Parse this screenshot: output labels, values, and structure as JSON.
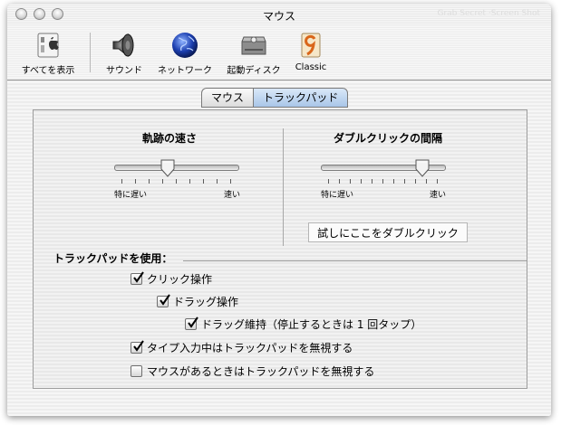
{
  "window": {
    "title": "マウス",
    "ghost_text": "Grab Secret ·Screen Shot"
  },
  "toolbar": {
    "items": [
      {
        "label": "すべてを表示",
        "icon": "show-all-icon"
      },
      {
        "label": "サウンド",
        "icon": "speaker-icon"
      },
      {
        "label": "ネットワーク",
        "icon": "globe-icon"
      },
      {
        "label": "起動ディスク",
        "icon": "hard-disk-icon"
      },
      {
        "label": "Classic",
        "icon": "classic-9-icon"
      }
    ]
  },
  "tabs": [
    {
      "label": "マウス",
      "selected": false
    },
    {
      "label": "トラックパッド",
      "selected": true
    }
  ],
  "tracking": {
    "heading": "軌跡の速さ",
    "min_label": "特に遅い",
    "max_label": "速い",
    "tick_count": 9,
    "position_fraction": 0.44
  },
  "double_click": {
    "heading": "ダブルクリックの間隔",
    "min_label": "特に遅い",
    "max_label": "速い",
    "tick_count": 11,
    "position_fraction": 0.82,
    "test_field_text": "試しにここをダブルクリック"
  },
  "usage": {
    "label": "トラックパッドを使用：",
    "options": [
      {
        "label": "クリック操作",
        "checked": true
      },
      {
        "label": "ドラッグ操作",
        "checked": true
      },
      {
        "label": "ドラッグ維持（停止するときは 1 回タップ）",
        "checked": true
      },
      {
        "label": "タイプ入力中はトラックパッドを無視する",
        "checked": true
      },
      {
        "label": "マウスがあるときはトラックパッドを無視する",
        "checked": false
      }
    ]
  },
  "colors": {
    "selected_tab": "#a9c6e8",
    "checkmark": "#000000"
  }
}
